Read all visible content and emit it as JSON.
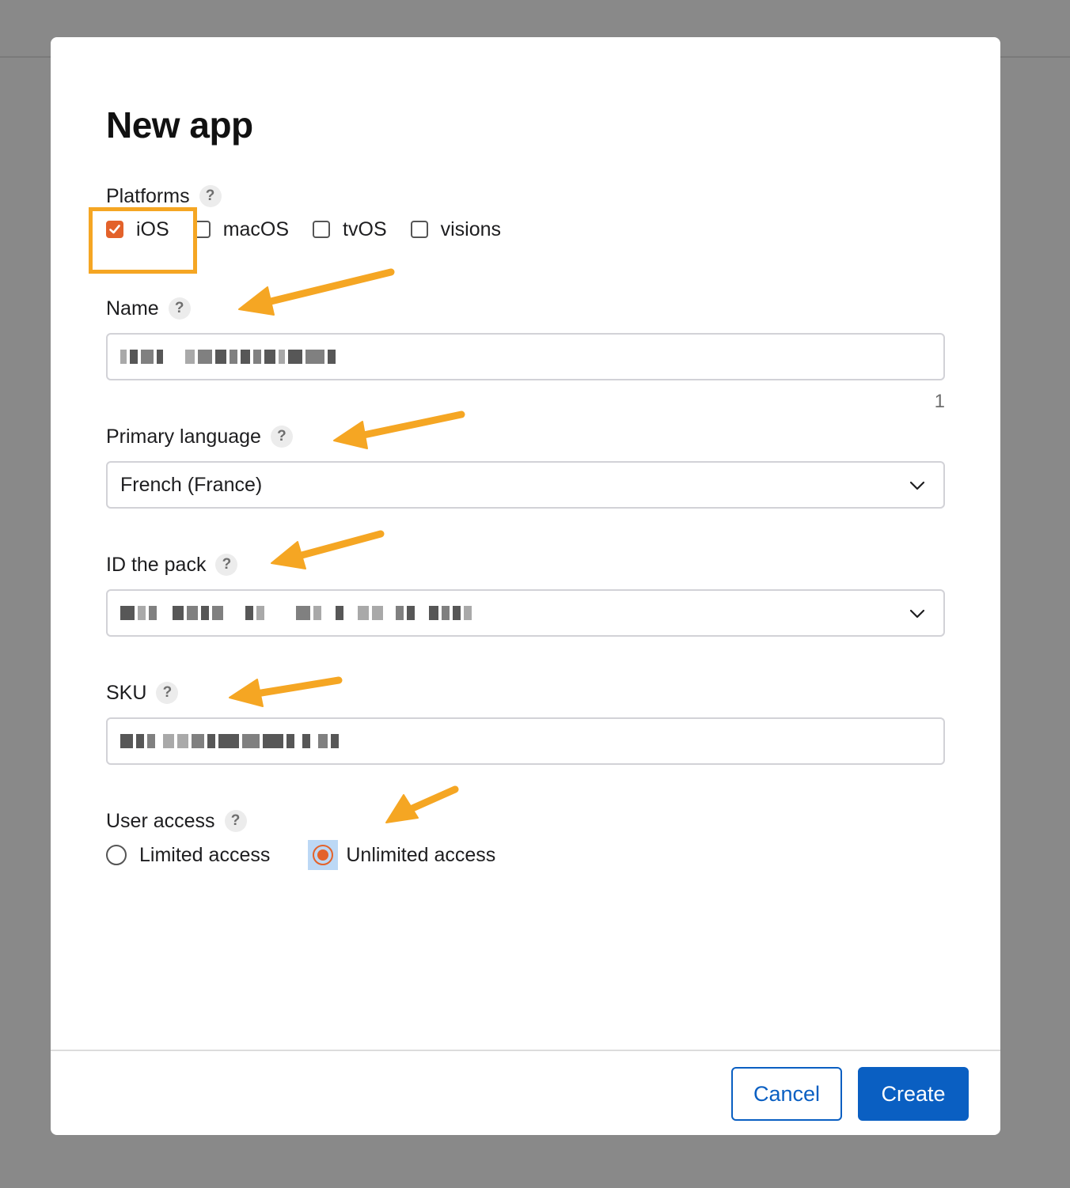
{
  "modal": {
    "title": "New app"
  },
  "platforms": {
    "label": "Platforms",
    "help": "?",
    "options": [
      {
        "label": "iOS",
        "checked": true
      },
      {
        "label": "macOS",
        "checked": false
      },
      {
        "label": "tvOS",
        "checked": false
      },
      {
        "label": "visions",
        "checked": false
      }
    ]
  },
  "name": {
    "label": "Name",
    "help": "?",
    "char_count": "1"
  },
  "primary_language": {
    "label": "Primary language",
    "help": "?",
    "value": "French (France)"
  },
  "bundle_id": {
    "label": "ID the pack",
    "help": "?"
  },
  "sku": {
    "label": "SKU",
    "help": "?"
  },
  "user_access": {
    "label": "User access",
    "help": "?",
    "options": [
      {
        "label": "Limited access",
        "selected": false
      },
      {
        "label": "Unlimited access",
        "selected": true
      }
    ]
  },
  "footer": {
    "cancel_label": "Cancel",
    "create_label": "Create"
  },
  "colors": {
    "accent": "#e3622b",
    "primary_button": "#0a5fc2",
    "annotation": "#f5a623"
  },
  "icons": {
    "help": "question-mark-icon",
    "select": "chevron-down-icon",
    "check": "checkmark-icon",
    "annotation": "arrow-icon"
  }
}
